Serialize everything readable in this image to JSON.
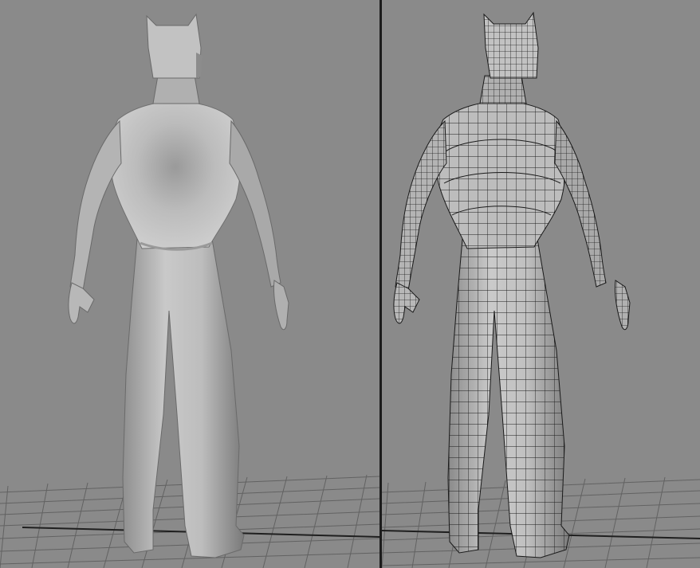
{
  "viewports": [
    {
      "shading": "smooth"
    },
    {
      "shading": "smooth-with-wireframe-edges"
    }
  ],
  "colors": {
    "viewport_background": "#8a8a8a",
    "grid_line": "#5f5f5f",
    "grid_main_axis": "#222222",
    "splitter": "#1c1c1c",
    "model_light": "#c4c4c4",
    "model_dark": "#6e6e6e",
    "wire": "#1a1a1a"
  }
}
